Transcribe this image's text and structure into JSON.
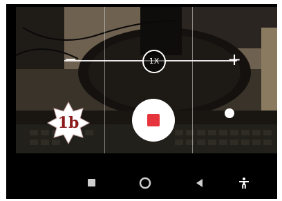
{
  "camera": {
    "zoom": {
      "minus_label": "−",
      "plus_label": "+",
      "level_label": "1X"
    },
    "record": {
      "state": "recording"
    }
  },
  "overlay": {
    "badge_label": "1b"
  },
  "navbar": {
    "recents_icon": "square-recents-icon",
    "home_icon": "circle-home-icon",
    "back_icon": "triangle-back-icon",
    "accessibility_icon": "accessibility-person-icon"
  },
  "colors": {
    "record_red": "#e6343c",
    "badge_text": "#8b1a1a",
    "badge_fill": "#ffffff"
  }
}
